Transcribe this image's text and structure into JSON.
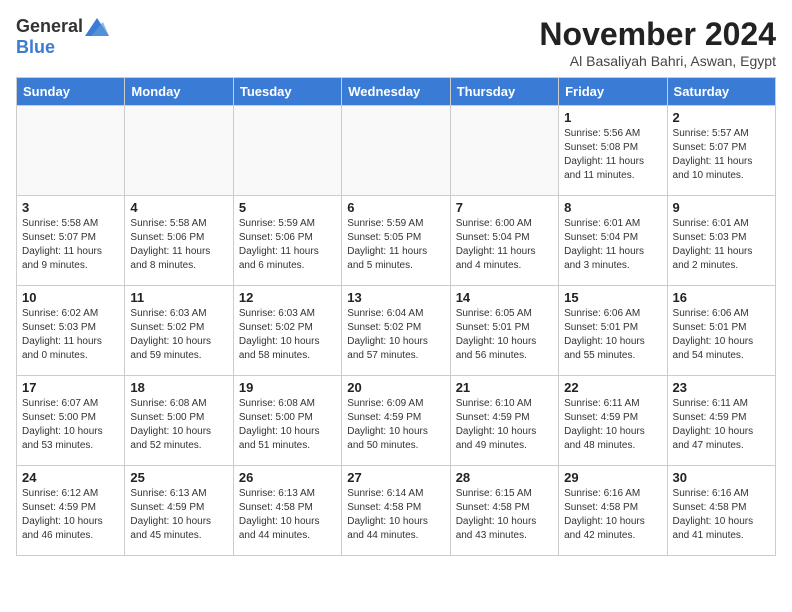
{
  "logo": {
    "general": "General",
    "blue": "Blue"
  },
  "header": {
    "month": "November 2024",
    "location": "Al Basaliyah Bahri, Aswan, Egypt"
  },
  "weekdays": [
    "Sunday",
    "Monday",
    "Tuesday",
    "Wednesday",
    "Thursday",
    "Friday",
    "Saturday"
  ],
  "weeks": [
    [
      {
        "day": "",
        "info": ""
      },
      {
        "day": "",
        "info": ""
      },
      {
        "day": "",
        "info": ""
      },
      {
        "day": "",
        "info": ""
      },
      {
        "day": "",
        "info": ""
      },
      {
        "day": "1",
        "info": "Sunrise: 5:56 AM\nSunset: 5:08 PM\nDaylight: 11 hours\nand 11 minutes."
      },
      {
        "day": "2",
        "info": "Sunrise: 5:57 AM\nSunset: 5:07 PM\nDaylight: 11 hours\nand 10 minutes."
      }
    ],
    [
      {
        "day": "3",
        "info": "Sunrise: 5:58 AM\nSunset: 5:07 PM\nDaylight: 11 hours\nand 9 minutes."
      },
      {
        "day": "4",
        "info": "Sunrise: 5:58 AM\nSunset: 5:06 PM\nDaylight: 11 hours\nand 8 minutes."
      },
      {
        "day": "5",
        "info": "Sunrise: 5:59 AM\nSunset: 5:06 PM\nDaylight: 11 hours\nand 6 minutes."
      },
      {
        "day": "6",
        "info": "Sunrise: 5:59 AM\nSunset: 5:05 PM\nDaylight: 11 hours\nand 5 minutes."
      },
      {
        "day": "7",
        "info": "Sunrise: 6:00 AM\nSunset: 5:04 PM\nDaylight: 11 hours\nand 4 minutes."
      },
      {
        "day": "8",
        "info": "Sunrise: 6:01 AM\nSunset: 5:04 PM\nDaylight: 11 hours\nand 3 minutes."
      },
      {
        "day": "9",
        "info": "Sunrise: 6:01 AM\nSunset: 5:03 PM\nDaylight: 11 hours\nand 2 minutes."
      }
    ],
    [
      {
        "day": "10",
        "info": "Sunrise: 6:02 AM\nSunset: 5:03 PM\nDaylight: 11 hours\nand 0 minutes."
      },
      {
        "day": "11",
        "info": "Sunrise: 6:03 AM\nSunset: 5:02 PM\nDaylight: 10 hours\nand 59 minutes."
      },
      {
        "day": "12",
        "info": "Sunrise: 6:03 AM\nSunset: 5:02 PM\nDaylight: 10 hours\nand 58 minutes."
      },
      {
        "day": "13",
        "info": "Sunrise: 6:04 AM\nSunset: 5:02 PM\nDaylight: 10 hours\nand 57 minutes."
      },
      {
        "day": "14",
        "info": "Sunrise: 6:05 AM\nSunset: 5:01 PM\nDaylight: 10 hours\nand 56 minutes."
      },
      {
        "day": "15",
        "info": "Sunrise: 6:06 AM\nSunset: 5:01 PM\nDaylight: 10 hours\nand 55 minutes."
      },
      {
        "day": "16",
        "info": "Sunrise: 6:06 AM\nSunset: 5:01 PM\nDaylight: 10 hours\nand 54 minutes."
      }
    ],
    [
      {
        "day": "17",
        "info": "Sunrise: 6:07 AM\nSunset: 5:00 PM\nDaylight: 10 hours\nand 53 minutes."
      },
      {
        "day": "18",
        "info": "Sunrise: 6:08 AM\nSunset: 5:00 PM\nDaylight: 10 hours\nand 52 minutes."
      },
      {
        "day": "19",
        "info": "Sunrise: 6:08 AM\nSunset: 5:00 PM\nDaylight: 10 hours\nand 51 minutes."
      },
      {
        "day": "20",
        "info": "Sunrise: 6:09 AM\nSunset: 4:59 PM\nDaylight: 10 hours\nand 50 minutes."
      },
      {
        "day": "21",
        "info": "Sunrise: 6:10 AM\nSunset: 4:59 PM\nDaylight: 10 hours\nand 49 minutes."
      },
      {
        "day": "22",
        "info": "Sunrise: 6:11 AM\nSunset: 4:59 PM\nDaylight: 10 hours\nand 48 minutes."
      },
      {
        "day": "23",
        "info": "Sunrise: 6:11 AM\nSunset: 4:59 PM\nDaylight: 10 hours\nand 47 minutes."
      }
    ],
    [
      {
        "day": "24",
        "info": "Sunrise: 6:12 AM\nSunset: 4:59 PM\nDaylight: 10 hours\nand 46 minutes."
      },
      {
        "day": "25",
        "info": "Sunrise: 6:13 AM\nSunset: 4:59 PM\nDaylight: 10 hours\nand 45 minutes."
      },
      {
        "day": "26",
        "info": "Sunrise: 6:13 AM\nSunset: 4:58 PM\nDaylight: 10 hours\nand 44 minutes."
      },
      {
        "day": "27",
        "info": "Sunrise: 6:14 AM\nSunset: 4:58 PM\nDaylight: 10 hours\nand 44 minutes."
      },
      {
        "day": "28",
        "info": "Sunrise: 6:15 AM\nSunset: 4:58 PM\nDaylight: 10 hours\nand 43 minutes."
      },
      {
        "day": "29",
        "info": "Sunrise: 6:16 AM\nSunset: 4:58 PM\nDaylight: 10 hours\nand 42 minutes."
      },
      {
        "day": "30",
        "info": "Sunrise: 6:16 AM\nSunset: 4:58 PM\nDaylight: 10 hours\nand 41 minutes."
      }
    ]
  ]
}
